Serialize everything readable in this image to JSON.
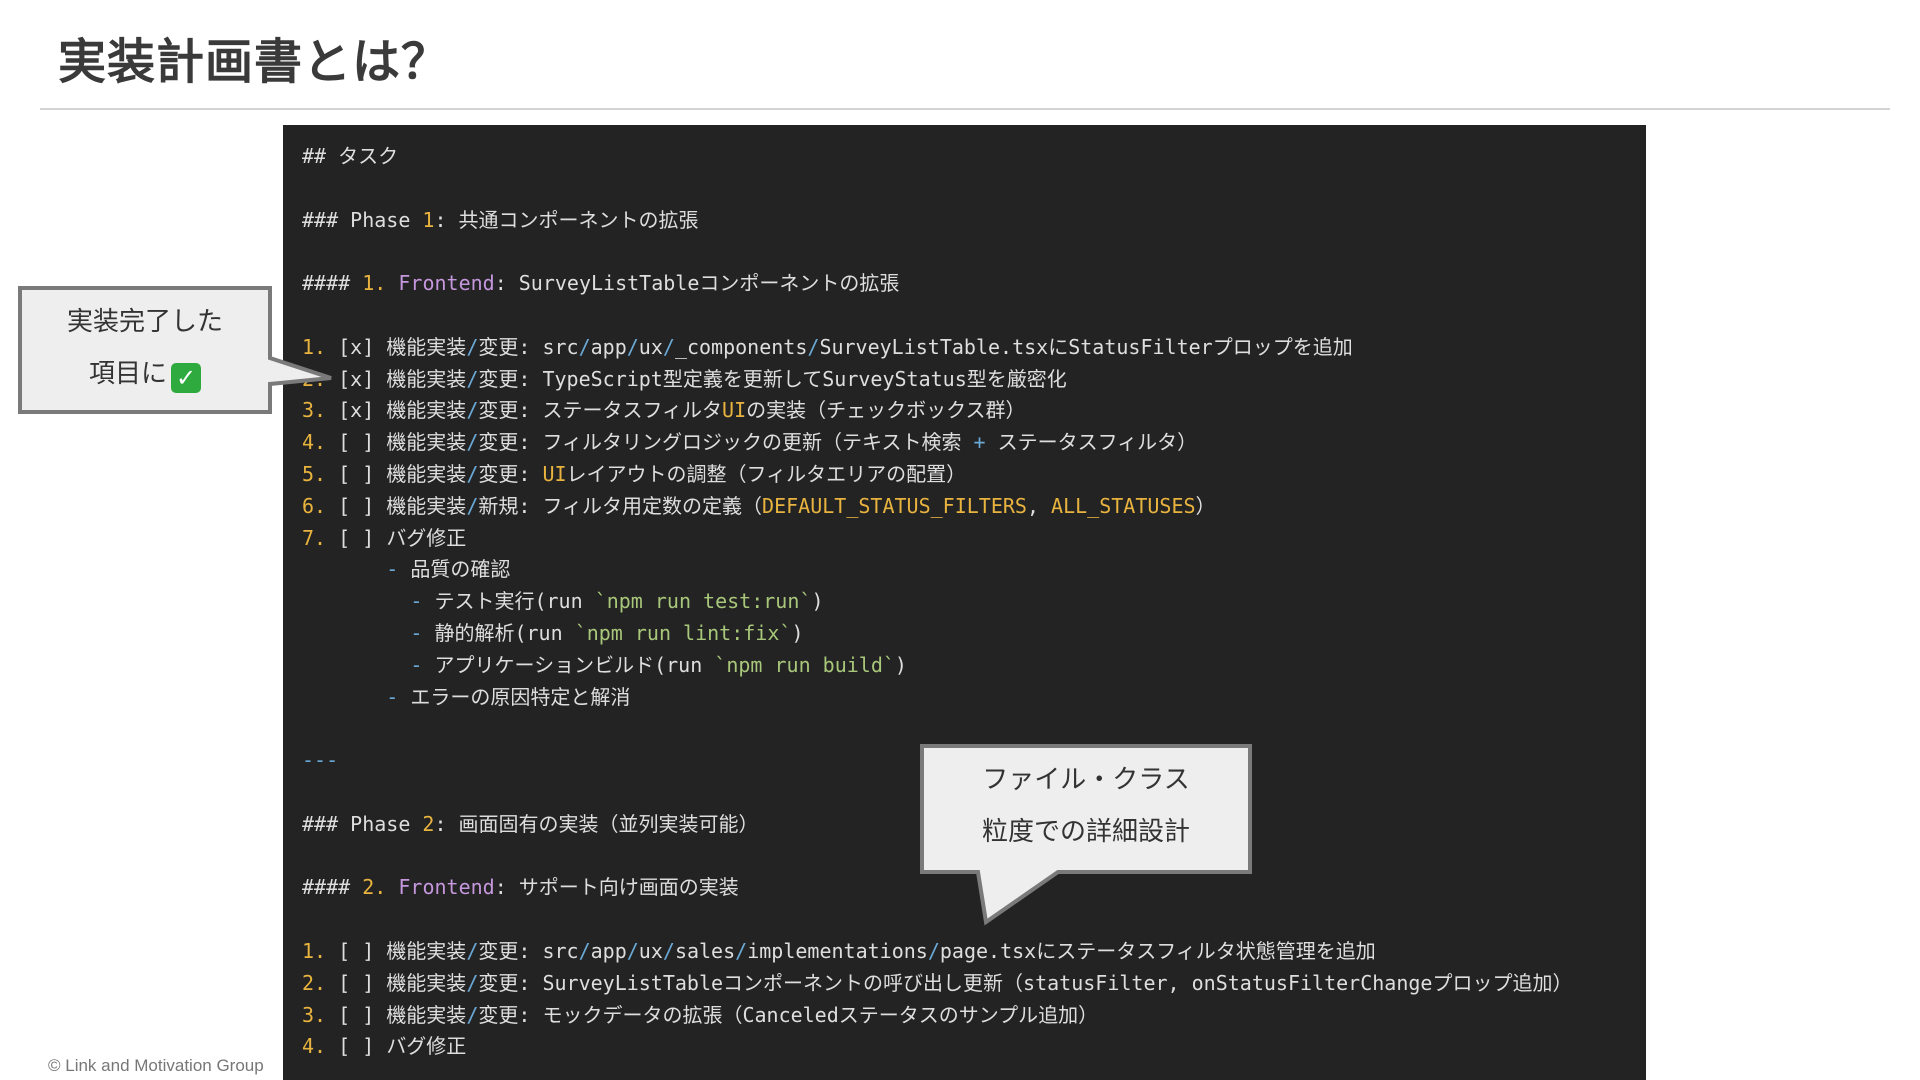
{
  "slide": {
    "title": "実装計画書とは？",
    "footer": "© Link and Motivation Group"
  },
  "code": {
    "heading_task": "## タスク",
    "phase1": {
      "prefix": "### Phase ",
      "num": "1",
      "rest": ": 共通コンポーネントの拡張"
    },
    "section1": {
      "prefix": "#### ",
      "num": "1.",
      "kw": "Frontend",
      "rest": ": SurveyListTableコンポーネントの拡張"
    },
    "p1_items": {
      "i1": {
        "n": "1.",
        "box": " [x] ",
        "label": "機能実装",
        "sep": "/",
        "verb": "変更",
        "colon": ": ",
        "s1": "src",
        "s2": "app",
        "s3": "ux",
        "s4": "_components",
        "tail": "SurveyListTable.tsxにStatusFilterプロップを追加"
      },
      "i2": {
        "n": "2.",
        "box": " [x] ",
        "label": "機能実装",
        "sep": "/",
        "verb": "変更",
        "text": ": TypeScript型定義を更新してSurveyStatus型を厳密化"
      },
      "i3": {
        "n": "3.",
        "box": " [x] ",
        "label": "機能実装",
        "sep": "/",
        "verb": "変更",
        "t1": ": ステータスフィルタ",
        "ui": "UI",
        "t2": "の実装（チェックボックス群）"
      },
      "i4": {
        "n": "4.",
        "box": " [ ] ",
        "label": "機能実装",
        "sep": "/",
        "verb": "変更",
        "t1": ": フィルタリングロジックの更新（テキスト検索 ",
        "plus": "+",
        "t2": " ステータスフィルタ）"
      },
      "i5": {
        "n": "5.",
        "box": " [ ] ",
        "label": "機能実装",
        "sep": "/",
        "verb": "変更",
        "colon": ": ",
        "ui": "UI",
        "t2": "レイアウトの調整（フィルタエリアの配置）"
      },
      "i6": {
        "n": "6.",
        "box": " [ ] ",
        "label": "機能実装",
        "sep": "/",
        "verb": "新規",
        "t1": ": フィルタ用定数の定義（",
        "c1": "DEFAULT_STATUS_FILTERS",
        "comma": ", ",
        "c2": "ALL_STATUSES",
        "t2": "）"
      },
      "i7": {
        "n": "7.",
        "box": " [ ] ",
        "text": "バグ修正"
      }
    },
    "sub": {
      "quality": "品質の確認",
      "test": {
        "pre": "テスト実行(run ",
        "cmd": "`npm run test:run`",
        "post": ")"
      },
      "lint": {
        "pre": "静的解析(run ",
        "cmd": "`npm run lint:fix`",
        "post": ")"
      },
      "build": {
        "pre": "アプリケーションビルド(run ",
        "cmd": "`npm run build`",
        "post": ")"
      },
      "errors": "エラーの原因特定と解消"
    },
    "hr": "---",
    "phase2": {
      "prefix": "### Phase ",
      "num": "2",
      "rest": ": 画面固有の実装（並列実装可能）"
    },
    "section2": {
      "prefix": "#### ",
      "num": "2.",
      "kw": "Frontend",
      "rest": ": サポート向け画面の実装"
    },
    "p2_items": {
      "i1": {
        "n": "1.",
        "box": " [ ] ",
        "label": "機能実装",
        "sep": "/",
        "verb": "変更",
        "colon": ": ",
        "s1": "src",
        "s2": "app",
        "s3": "ux",
        "s4": "sales",
        "s5": "implementations",
        "tail": "page.tsxにステータスフィルタ状態管理を追加"
      },
      "i2": {
        "n": "2.",
        "box": " [ ] ",
        "label": "機能実装",
        "sep": "/",
        "verb": "変更",
        "text": ": SurveyListTableコンポーネントの呼び出し更新（statusFilter, onStatusFilterChangeプロップ追加）"
      },
      "i3": {
        "n": "3.",
        "box": " [ ] ",
        "label": "機能実装",
        "sep": "/",
        "verb": "変更",
        "text": ": モックデータの拡張（Canceledステータスのサンプル追加）"
      },
      "i4": {
        "n": "4.",
        "box": " [ ] ",
        "text": "バグ修正"
      }
    }
  },
  "callouts": {
    "left": {
      "line1": "実装完了した",
      "line2": "項目に",
      "emoji": "✅",
      "emoji_icon": "check-mark-button-icon"
    },
    "right": {
      "line1": "ファイル・クラス",
      "line2": "粒度での詳細設計"
    }
  },
  "colors": {
    "code_bg": "#232323",
    "number": "#e8b33e",
    "keyword": "#c597dd",
    "command": "#a8c77a",
    "separator": "#6aa9d6",
    "callout_fill": "#eeeeee",
    "callout_border": "#7a7a7a"
  }
}
